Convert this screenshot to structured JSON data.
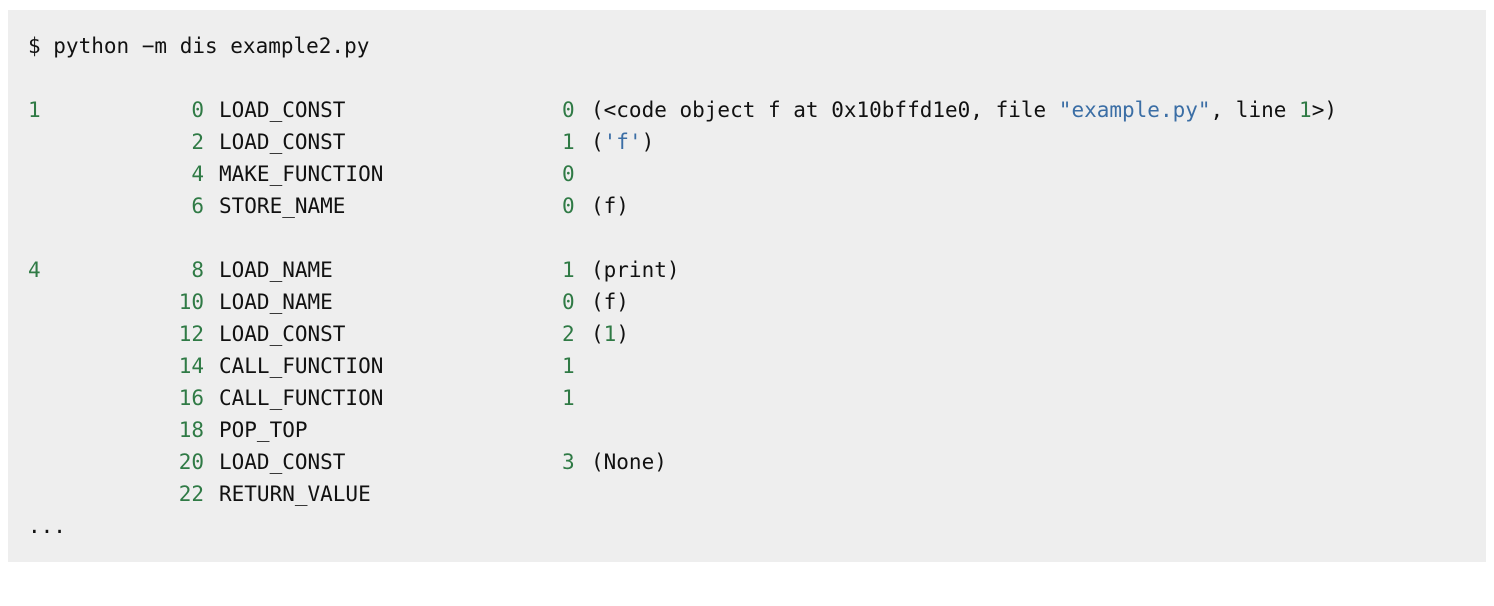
{
  "command": "$ python −m dis example2.py",
  "ellipsis": "...",
  "rows": [
    {
      "src": "1",
      "off": "0",
      "op": "LOAD_CONST",
      "arg": "0",
      "anno": [
        {
          "t": "(<code object f at 0x10bffd1e0, file ",
          "k": "plain"
        },
        {
          "t": "\"example.py\"",
          "k": "str"
        },
        {
          "t": ", line ",
          "k": "plain"
        },
        {
          "t": "1",
          "k": "num"
        },
        {
          "t": ">)",
          "k": "plain"
        }
      ]
    },
    {
      "src": "",
      "off": "2",
      "op": "LOAD_CONST",
      "arg": "1",
      "anno": [
        {
          "t": "(",
          "k": "plain"
        },
        {
          "t": "'f'",
          "k": "str"
        },
        {
          "t": ")",
          "k": "plain"
        }
      ]
    },
    {
      "src": "",
      "off": "4",
      "op": "MAKE_FUNCTION",
      "arg": "0",
      "anno": []
    },
    {
      "src": "",
      "off": "6",
      "op": "STORE_NAME",
      "arg": "0",
      "anno": [
        {
          "t": "(f)",
          "k": "plain"
        }
      ]
    },
    {
      "src": "4",
      "off": "8",
      "op": "LOAD_NAME",
      "arg": "1",
      "anno": [
        {
          "t": "(print)",
          "k": "plain"
        }
      ]
    },
    {
      "src": "",
      "off": "10",
      "op": "LOAD_NAME",
      "arg": "0",
      "anno": [
        {
          "t": "(f)",
          "k": "plain"
        }
      ]
    },
    {
      "src": "",
      "off": "12",
      "op": "LOAD_CONST",
      "arg": "2",
      "anno": [
        {
          "t": "(",
          "k": "plain"
        },
        {
          "t": "1",
          "k": "num"
        },
        {
          "t": ")",
          "k": "plain"
        }
      ]
    },
    {
      "src": "",
      "off": "14",
      "op": "CALL_FUNCTION",
      "arg": "1",
      "anno": []
    },
    {
      "src": "",
      "off": "16",
      "op": "CALL_FUNCTION",
      "arg": "1",
      "anno": []
    },
    {
      "src": "",
      "off": "18",
      "op": "POP_TOP",
      "arg": "",
      "anno": []
    },
    {
      "src": "",
      "off": "20",
      "op": "LOAD_CONST",
      "arg": "3",
      "anno": [
        {
          "t": "(None)",
          "k": "plain"
        }
      ]
    },
    {
      "src": "",
      "off": "22",
      "op": "RETURN_VALUE",
      "arg": "",
      "anno": []
    }
  ]
}
